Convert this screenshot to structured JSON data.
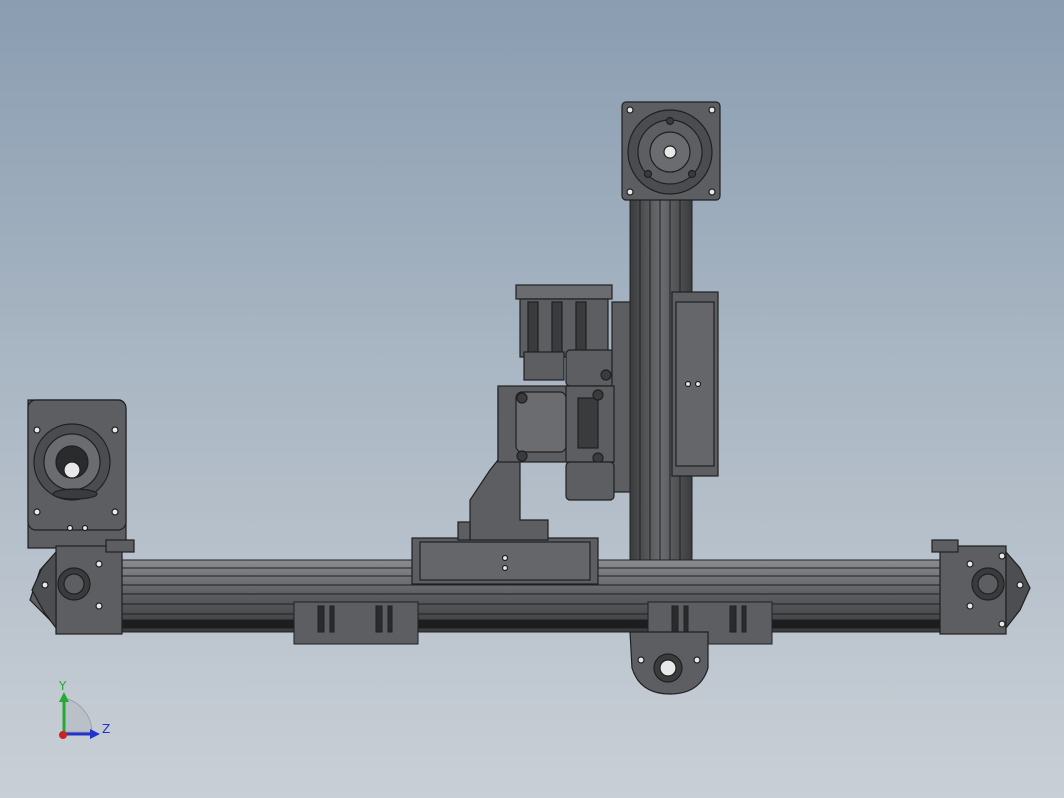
{
  "viewport": {
    "background_top": "#8a9db1",
    "background_bottom": "#c9cfd6",
    "model_fill": "#5c5e61",
    "model_dark": "#2a2b2d",
    "model_light": "#7f8184"
  },
  "triad": {
    "y_label": "Y",
    "z_label": "Z",
    "y_color": "#22aa33",
    "z_color": "#2233cc",
    "x_color": "#cc2222"
  }
}
